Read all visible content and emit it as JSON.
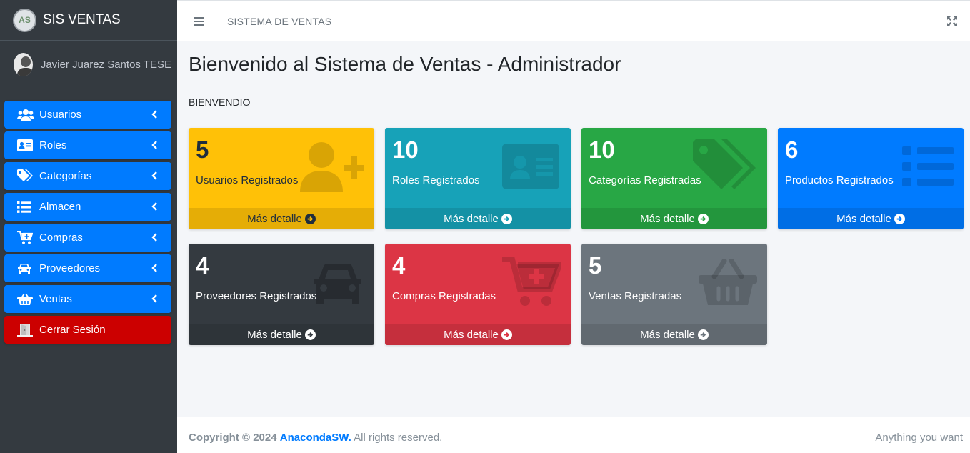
{
  "brand": {
    "title": "SIS VENTAS",
    "logo_text": "AS"
  },
  "user": {
    "name": "Javier Juarez Santos TESE"
  },
  "sidebar": {
    "items": [
      {
        "label": "Usuarios",
        "icon": "users-icon"
      },
      {
        "label": "Roles",
        "icon": "id-card-icon"
      },
      {
        "label": "Categorías",
        "icon": "tags-icon"
      },
      {
        "label": "Almacen",
        "icon": "list-icon"
      },
      {
        "label": "Compras",
        "icon": "cart-plus-icon"
      },
      {
        "label": "Proveedores",
        "icon": "car-icon"
      },
      {
        "label": "Ventas",
        "icon": "basket-icon"
      },
      {
        "label": "Cerrar Sesión",
        "icon": "door-icon"
      }
    ]
  },
  "header": {
    "title": "SISTEMA DE VENTAS"
  },
  "main": {
    "title": "Bienvenido al Sistema de Ventas - Administrador",
    "welcome": "BIENVENDIO",
    "more_label": "Más detalle",
    "boxes": [
      {
        "value": "5",
        "label": "Usuarios Registrados",
        "color": "#ffc107",
        "icon": "user-plus-icon"
      },
      {
        "value": "10",
        "label": "Roles Registrados",
        "color": "#17a2b8",
        "icon": "id-card-icon"
      },
      {
        "value": "10",
        "label": "Categorías Registradas",
        "color": "#28a745",
        "icon": "tags-icon"
      },
      {
        "value": "6",
        "label": "Productos Registrados",
        "color": "#007bff",
        "icon": "list-icon"
      },
      {
        "value": "4",
        "label": "Proveedores Registrados",
        "color": "#343a40",
        "icon": "car-icon"
      },
      {
        "value": "4",
        "label": "Compras Registradas",
        "color": "#dc3545",
        "icon": "cart-plus-icon"
      },
      {
        "value": "5",
        "label": "Ventas Registradas",
        "color": "#6c757d",
        "icon": "basket-icon"
      }
    ]
  },
  "footer": {
    "copyright": "Copyright © 2024",
    "company": "AnacondaSW.",
    "rights": "All rights reserved.",
    "right_text": "Anything you want"
  }
}
